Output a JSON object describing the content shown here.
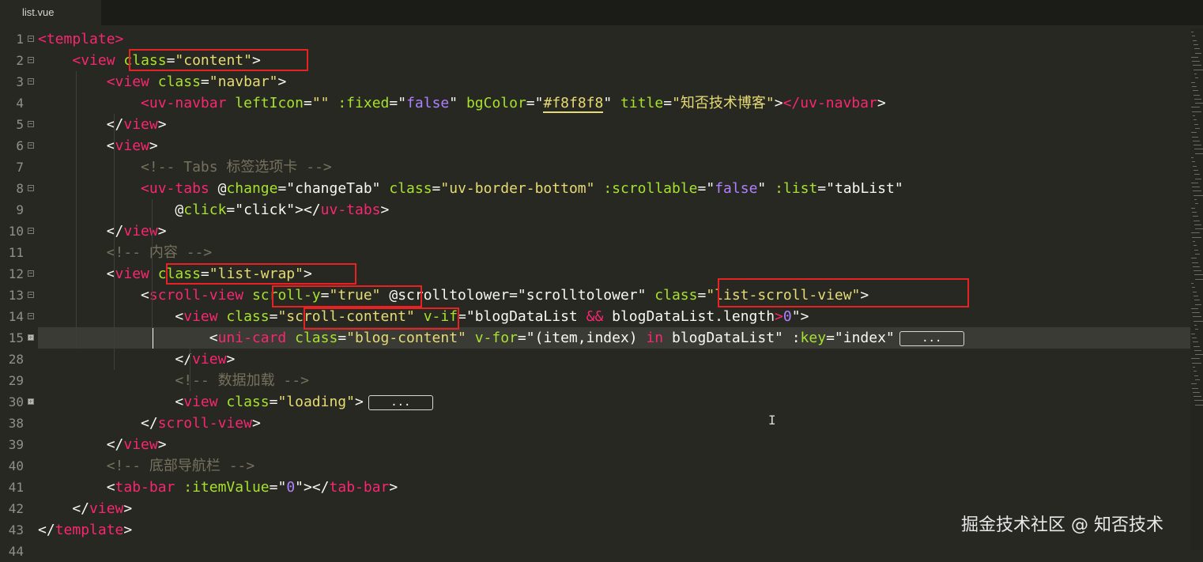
{
  "editor": {
    "tab": "list.vue",
    "watermark": "掘金技术社区 @ 知否技术",
    "collapsed_marker": "...",
    "lines": [
      {
        "num": "1",
        "fold": "minus",
        "tokens": [
          [
            "tag",
            "<template>"
          ]
        ]
      },
      {
        "num": "2",
        "fold": "minus",
        "tokens": [
          [
            "text",
            "    "
          ],
          [
            "tag",
            "<view "
          ],
          [
            "attr",
            "class"
          ],
          [
            "text",
            "="
          ],
          [
            "str",
            "\"content\""
          ],
          [
            "text",
            ">"
          ]
        ]
      },
      {
        "num": "3",
        "fold": "minus",
        "tokens": [
          [
            "text",
            "        "
          ],
          [
            "tag",
            "<view "
          ],
          [
            "attr",
            "class"
          ],
          [
            "text",
            "="
          ],
          [
            "str",
            "\"navbar\""
          ],
          [
            "text",
            ">"
          ]
        ]
      },
      {
        "num": "4",
        "fold": "",
        "tokens": [
          [
            "text",
            "            "
          ],
          [
            "tag",
            "<uv-navbar "
          ],
          [
            "attr",
            "leftIcon"
          ],
          [
            "text",
            "="
          ],
          [
            "str",
            "\"\""
          ],
          [
            "text",
            " "
          ],
          [
            "attr",
            ":fixed"
          ],
          [
            "text",
            "=\""
          ],
          [
            "bool",
            "false"
          ],
          [
            "text",
            "\" "
          ],
          [
            "attr",
            "bgColor"
          ],
          [
            "text",
            "=\""
          ],
          [
            "ustr",
            "#f8f8f8"
          ],
          [
            "text",
            "\" "
          ],
          [
            "attr",
            "title"
          ],
          [
            "text",
            "="
          ],
          [
            "str",
            "\"知否技术博客\""
          ],
          [
            "text",
            ">"
          ],
          [
            "tag",
            "</uv-navbar"
          ],
          [
            "text",
            ">"
          ]
        ]
      },
      {
        "num": "5",
        "fold": "minus",
        "tokens": [
          [
            "text",
            "        </"
          ],
          [
            "tag",
            "view"
          ],
          [
            "text",
            ">"
          ]
        ]
      },
      {
        "num": "6",
        "fold": "minus",
        "tokens": [
          [
            "text",
            "        <"
          ],
          [
            "tag",
            "view"
          ],
          [
            "text",
            ">"
          ]
        ]
      },
      {
        "num": "7",
        "fold": "",
        "tokens": [
          [
            "text",
            "            "
          ],
          [
            "com",
            "<!-- Tabs 标签选项卡 -->"
          ]
        ]
      },
      {
        "num": "8",
        "fold": "minus",
        "tokens": [
          [
            "text",
            "            "
          ],
          [
            "tag",
            "<uv-tabs "
          ],
          [
            "text",
            "@"
          ],
          [
            "attr",
            "change"
          ],
          [
            "text",
            "=\"changeTab\" "
          ],
          [
            "attr",
            "class"
          ],
          [
            "text",
            "="
          ],
          [
            "str",
            "\"uv-border-bottom\""
          ],
          [
            "text",
            " "
          ],
          [
            "attr",
            ":scrollable"
          ],
          [
            "text",
            "=\""
          ],
          [
            "bool",
            "false"
          ],
          [
            "text",
            "\" "
          ],
          [
            "attr",
            ":list"
          ],
          [
            "text",
            "=\"tabList\""
          ]
        ]
      },
      {
        "num": "9",
        "fold": "",
        "tokens": [
          [
            "text",
            "                @"
          ],
          [
            "attr",
            "click"
          ],
          [
            "text",
            "=\"click\"></"
          ],
          [
            "tag",
            "uv-tabs"
          ],
          [
            "text",
            ">"
          ]
        ]
      },
      {
        "num": "10",
        "fold": "minus",
        "tokens": [
          [
            "text",
            "        </"
          ],
          [
            "tag",
            "view"
          ],
          [
            "text",
            ">"
          ]
        ]
      },
      {
        "num": "11",
        "fold": "",
        "tokens": [
          [
            "text",
            "        "
          ],
          [
            "com",
            "<!-- 内容 -->"
          ]
        ]
      },
      {
        "num": "12",
        "fold": "minus",
        "tokens": [
          [
            "text",
            "        <"
          ],
          [
            "tag",
            "view "
          ],
          [
            "attr",
            "class"
          ],
          [
            "text",
            "="
          ],
          [
            "str",
            "\"list-wrap\""
          ],
          [
            "text",
            ">"
          ]
        ]
      },
      {
        "num": "13",
        "fold": "minus",
        "tokens": [
          [
            "text",
            "            <"
          ],
          [
            "tag",
            "scroll-view "
          ],
          [
            "attr",
            "scroll-y"
          ],
          [
            "text",
            "="
          ],
          [
            "str",
            "\"true\""
          ],
          [
            "text",
            " @scrolltolower=\"scrolltolower\" "
          ],
          [
            "attr",
            "class"
          ],
          [
            "text",
            "="
          ],
          [
            "str",
            "\"list-scroll-view\""
          ],
          [
            "text",
            ">"
          ]
        ]
      },
      {
        "num": "14",
        "fold": "minus",
        "tokens": [
          [
            "text",
            "                <"
          ],
          [
            "tag",
            "view "
          ],
          [
            "attr",
            "class"
          ],
          [
            "text",
            "="
          ],
          [
            "str",
            "\"scroll-content\""
          ],
          [
            "text",
            " "
          ],
          [
            "attr",
            "v-if"
          ],
          [
            "text",
            "=\"blogDataList "
          ],
          [
            "kw",
            "&&"
          ],
          [
            "text",
            " blogDataList.length"
          ],
          [
            "kw",
            ">"
          ],
          [
            "num",
            "0"
          ],
          [
            "text",
            "\">"
          ]
        ]
      },
      {
        "num": "15",
        "fold": "plus",
        "current": true,
        "tokens": [
          [
            "text",
            "                    <"
          ],
          [
            "tag",
            "uni-card "
          ],
          [
            "attr",
            "class"
          ],
          [
            "text",
            "="
          ],
          [
            "str",
            "\"blog-content\""
          ],
          [
            "text",
            " "
          ],
          [
            "attr",
            "v-for"
          ],
          [
            "text",
            "=\"(item,index) "
          ],
          [
            "kw",
            "in"
          ],
          [
            "text",
            " blogDataList\" :"
          ],
          [
            "attr",
            "key"
          ],
          [
            "text",
            "=\"index\""
          ],
          [
            "box",
            "..."
          ]
        ]
      },
      {
        "num": "28",
        "fold": "",
        "tokens": [
          [
            "text",
            "                </"
          ],
          [
            "tag",
            "view"
          ],
          [
            "text",
            ">"
          ]
        ]
      },
      {
        "num": "29",
        "fold": "",
        "tokens": [
          [
            "text",
            "                "
          ],
          [
            "com",
            "<!-- 数据加载 -->"
          ]
        ]
      },
      {
        "num": "30",
        "fold": "plus",
        "tokens": [
          [
            "text",
            "                <"
          ],
          [
            "tag",
            "view "
          ],
          [
            "attr",
            "class"
          ],
          [
            "text",
            "="
          ],
          [
            "str",
            "\"loading\""
          ],
          [
            "text",
            ">"
          ],
          [
            "box",
            "..."
          ]
        ]
      },
      {
        "num": "38",
        "fold": "",
        "tokens": [
          [
            "text",
            "            </"
          ],
          [
            "tag",
            "scroll-view"
          ],
          [
            "text",
            ">"
          ]
        ]
      },
      {
        "num": "39",
        "fold": "",
        "tokens": [
          [
            "text",
            "        </"
          ],
          [
            "tag",
            "view"
          ],
          [
            "text",
            ">"
          ]
        ]
      },
      {
        "num": "40",
        "fold": "",
        "tokens": [
          [
            "text",
            "        "
          ],
          [
            "com",
            "<!-- 底部导航栏 -->"
          ]
        ]
      },
      {
        "num": "41",
        "fold": "",
        "tokens": [
          [
            "text",
            "        <"
          ],
          [
            "tag",
            "tab-bar "
          ],
          [
            "attr",
            ":itemValue"
          ],
          [
            "text",
            "=\""
          ],
          [
            "num",
            "0"
          ],
          [
            "text",
            "\"></"
          ],
          [
            "tag",
            "tab-bar"
          ],
          [
            "text",
            ">"
          ]
        ]
      },
      {
        "num": "42",
        "fold": "",
        "tokens": [
          [
            "text",
            "    </"
          ],
          [
            "tag",
            "view"
          ],
          [
            "text",
            ">"
          ]
        ]
      },
      {
        "num": "43",
        "fold": "",
        "tokens": [
          [
            "text",
            "</"
          ],
          [
            "tag",
            "template"
          ],
          [
            "text",
            ">"
          ]
        ]
      },
      {
        "num": "44",
        "fold": "",
        "tokens": []
      }
    ]
  },
  "colors": {
    "background": "#272822",
    "tag": "#f92672",
    "attribute": "#a6e22e",
    "string": "#e6db74",
    "comment": "#75715e",
    "literal": "#ae81ff",
    "highlight_box": "#e62222"
  }
}
